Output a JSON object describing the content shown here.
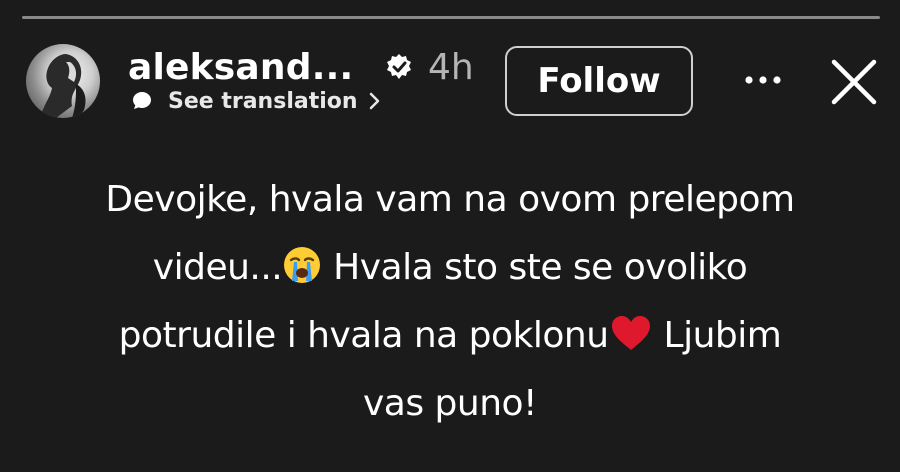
{
  "story": {
    "progress_segments": 1
  },
  "header": {
    "username": "aleksand...",
    "time": "4h",
    "translate_label": "See translation",
    "follow_label": "Follow",
    "more_icon": "more-horizontal-icon",
    "close_icon": "close-icon",
    "verified_icon": "verified-badge-icon"
  },
  "caption": {
    "line1": "Devojke, hvala vam na ovom prelepom",
    "line2_a": "videu...",
    "line2_emoji": "crying-face",
    "line2_b": " Hvala sto ste se ovoliko",
    "line3_a": "potrudile i hvala na poklonu",
    "line3_emoji": "red-heart",
    "line3_b": " Ljubim",
    "line4": "vas puno!"
  },
  "colors": {
    "background": "#1b1b1b",
    "text": "#ffffff",
    "muted": "#b5b5b5",
    "heart": "#e0182d",
    "emoji_face": "#ffcc33",
    "emoji_tears": "#3b9df0"
  }
}
